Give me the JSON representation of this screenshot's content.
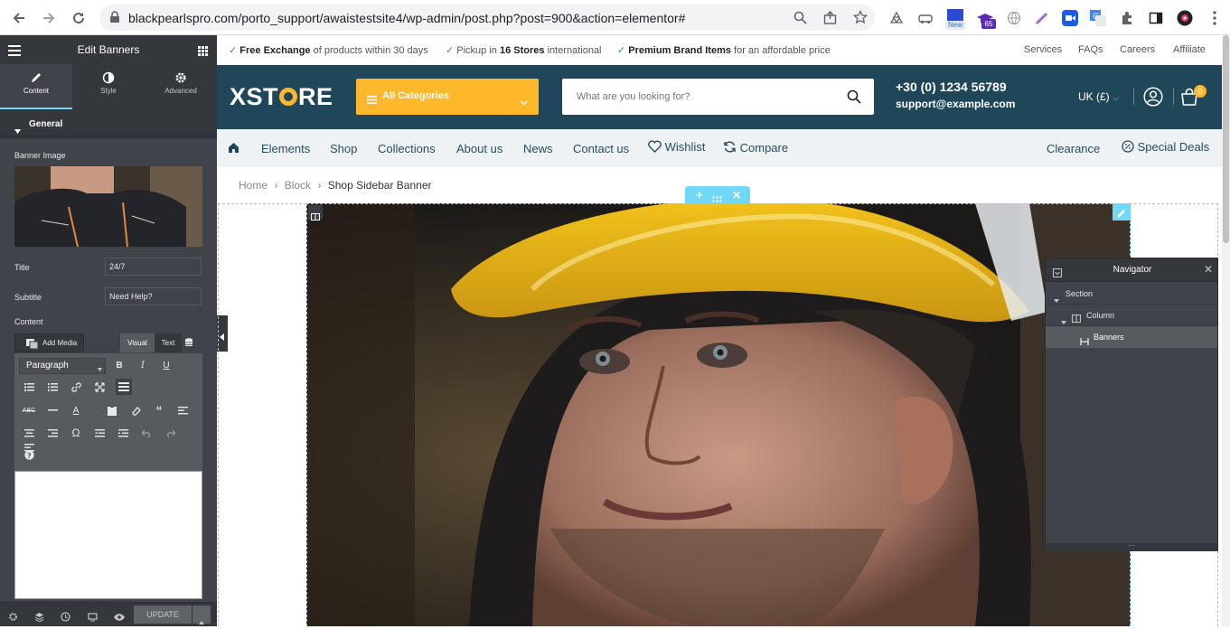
{
  "browser": {
    "url": "blackpearlspro.com/porto_support/awaistestsite4/wp-admin/post.php?post=900&action=elementor#",
    "ext_badge_new": "New",
    "ext_badge_count": "65"
  },
  "sidebar": {
    "title": "Edit Banners",
    "tabs": [
      {
        "label": "Content"
      },
      {
        "label": "Style"
      },
      {
        "label": "Advanced"
      }
    ],
    "section_label": "General",
    "banner_image_label": "Banner Image",
    "title_label": "Title",
    "title_value": "24/7",
    "subtitle_label": "Subtitle",
    "subtitle_value": "Need Help?",
    "content_label": "Content",
    "add_media_label": "Add Media",
    "visual_tab": "Visual",
    "text_tab": "Text",
    "format_select": "Paragraph",
    "update_button": "UPDATE"
  },
  "topbar": {
    "notice1_bold": "Free Exchange",
    "notice1_rest": " of products within 30 days",
    "notice2_pre": "Pickup in ",
    "notice2_bold": "16 Stores",
    "notice2_rest": " international",
    "notice3_bold": "Premium Brand Items",
    "notice3_rest": " for an affordable price",
    "links": [
      "Services",
      "FAQs",
      "Careers",
      "Affiliate"
    ]
  },
  "header": {
    "logo_pre": "XST",
    "logo_post": "RE",
    "categories_label": "All Categories",
    "search_placeholder": "What are you looking for?",
    "phone": "+30 (0) 1234 56789",
    "email": "support@example.com",
    "currency": "UK (£)",
    "cart_count": "0"
  },
  "menu": {
    "items": [
      "Elements",
      "Shop",
      "Collections",
      "About us",
      "News",
      "Contact us",
      "Wishlist",
      "Compare"
    ],
    "right_items": [
      "Clearance",
      "Special Deals"
    ]
  },
  "breadcrumb": {
    "items": [
      "Home",
      "Block",
      "Shop Sidebar Banner"
    ]
  },
  "navigator": {
    "title": "Navigator",
    "items": [
      {
        "label": "Section"
      },
      {
        "label": "Column"
      },
      {
        "label": "Banners"
      }
    ]
  },
  "colors": {
    "header_bg": "#1f4659",
    "accent_yellow": "#ffb72c",
    "editor_dark": "#404349",
    "editor_outline": "#71d7f7"
  }
}
